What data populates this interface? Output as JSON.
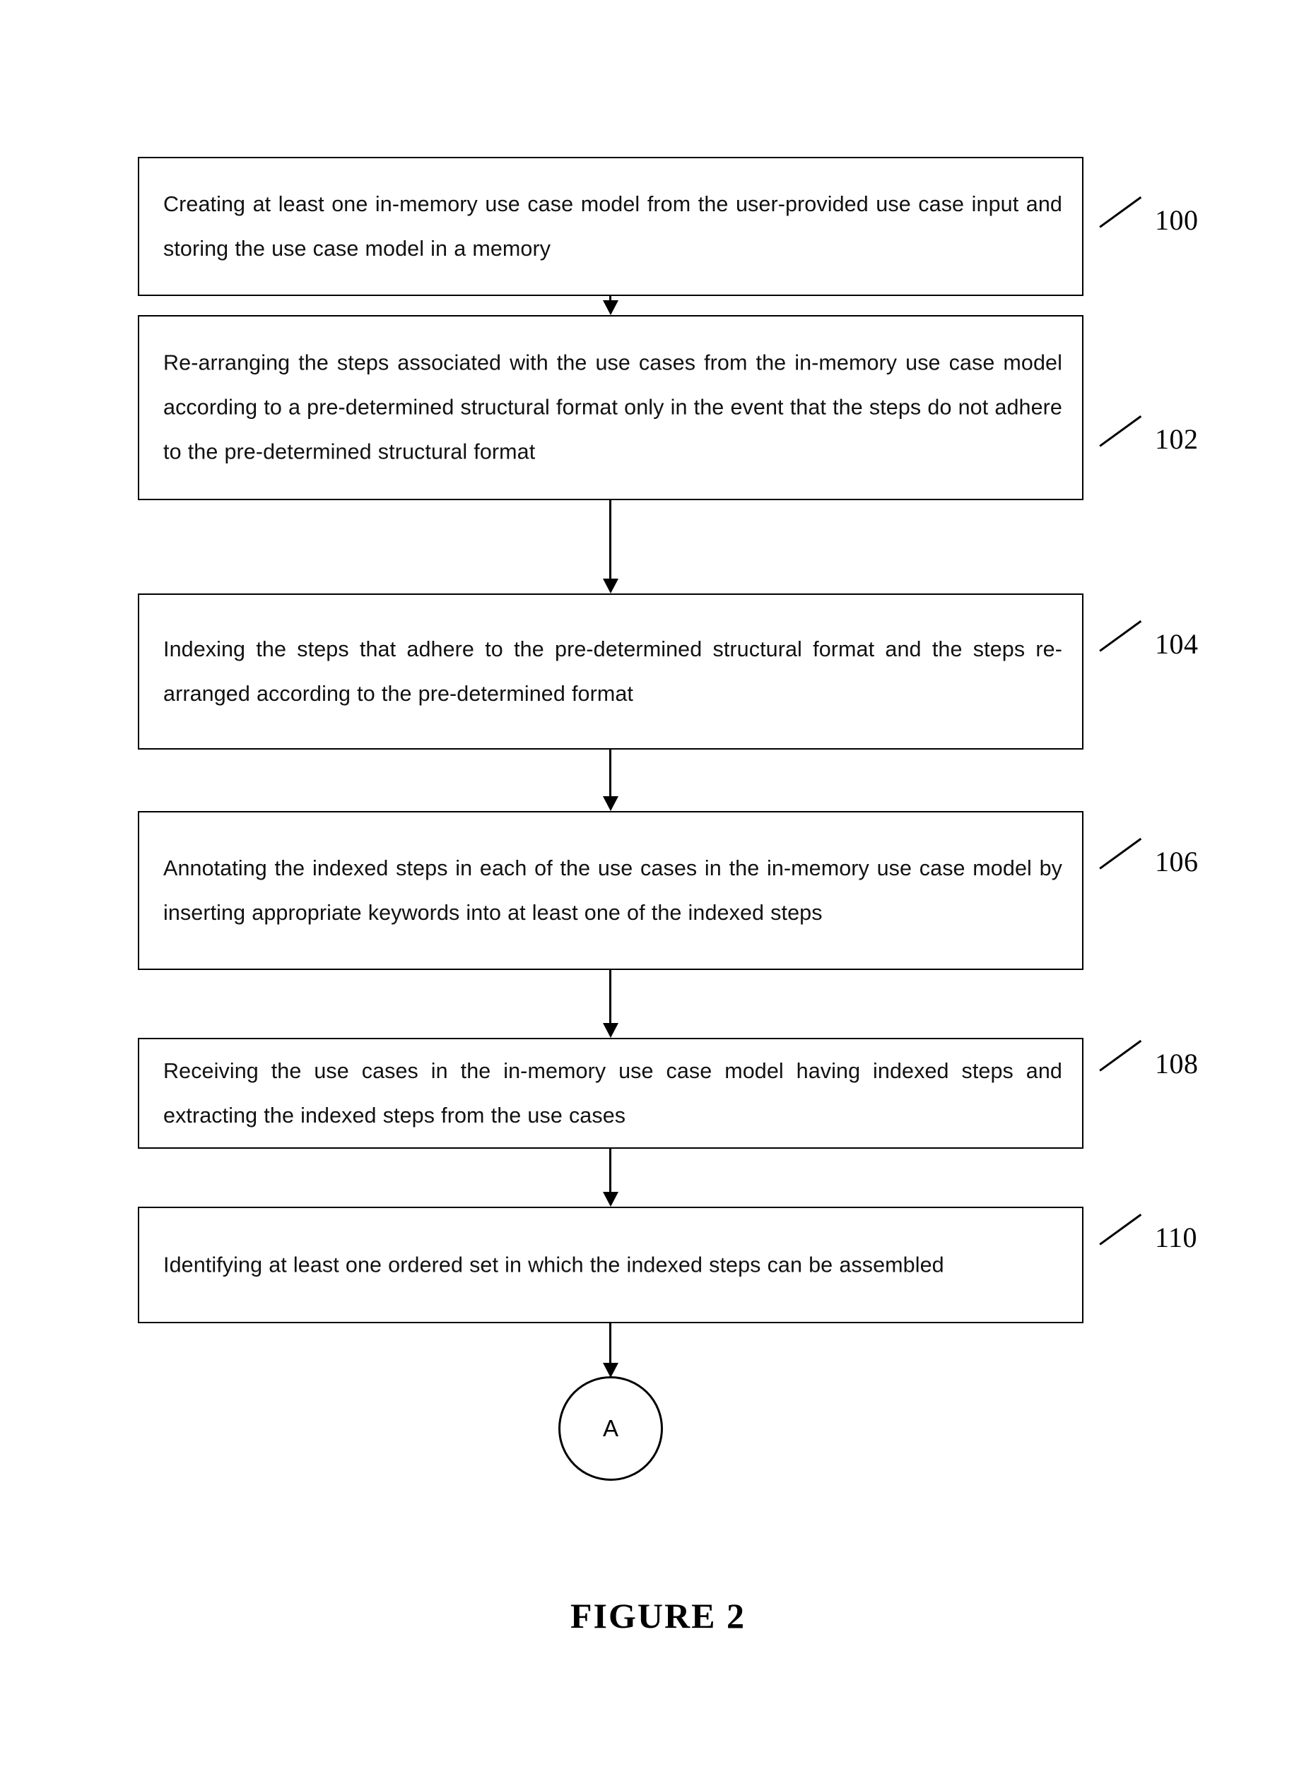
{
  "figure": {
    "caption": "FIGURE 2",
    "connector_label": "A"
  },
  "steps": [
    {
      "ref": "100",
      "text": "Creating at least one in-memory use case model from the user-provided use case input and storing the use case model in a memory"
    },
    {
      "ref": "102",
      "text": "Re-arranging the steps associated with the use cases from the in-memory use case model according to a pre-determined structural format only in the event that the steps do not adhere to the pre-determined structural format"
    },
    {
      "ref": "104",
      "text": "Indexing the steps that adhere to the pre-determined structural format and the steps re-arranged according to the pre-determined format"
    },
    {
      "ref": "106",
      "text": "Annotating the indexed steps in each of the use cases in the in-memory use case model by inserting appropriate keywords into at least one of the indexed steps"
    },
    {
      "ref": "108",
      "text": "Receiving the use cases in the in-memory use case model having indexed steps and extracting the indexed steps from the use cases"
    },
    {
      "ref": "110",
      "text": "Identifying at least one ordered set in which the indexed steps can be assembled"
    }
  ],
  "colors": {
    "line": "#000000",
    "background": "#ffffff",
    "text": "#111111"
  }
}
